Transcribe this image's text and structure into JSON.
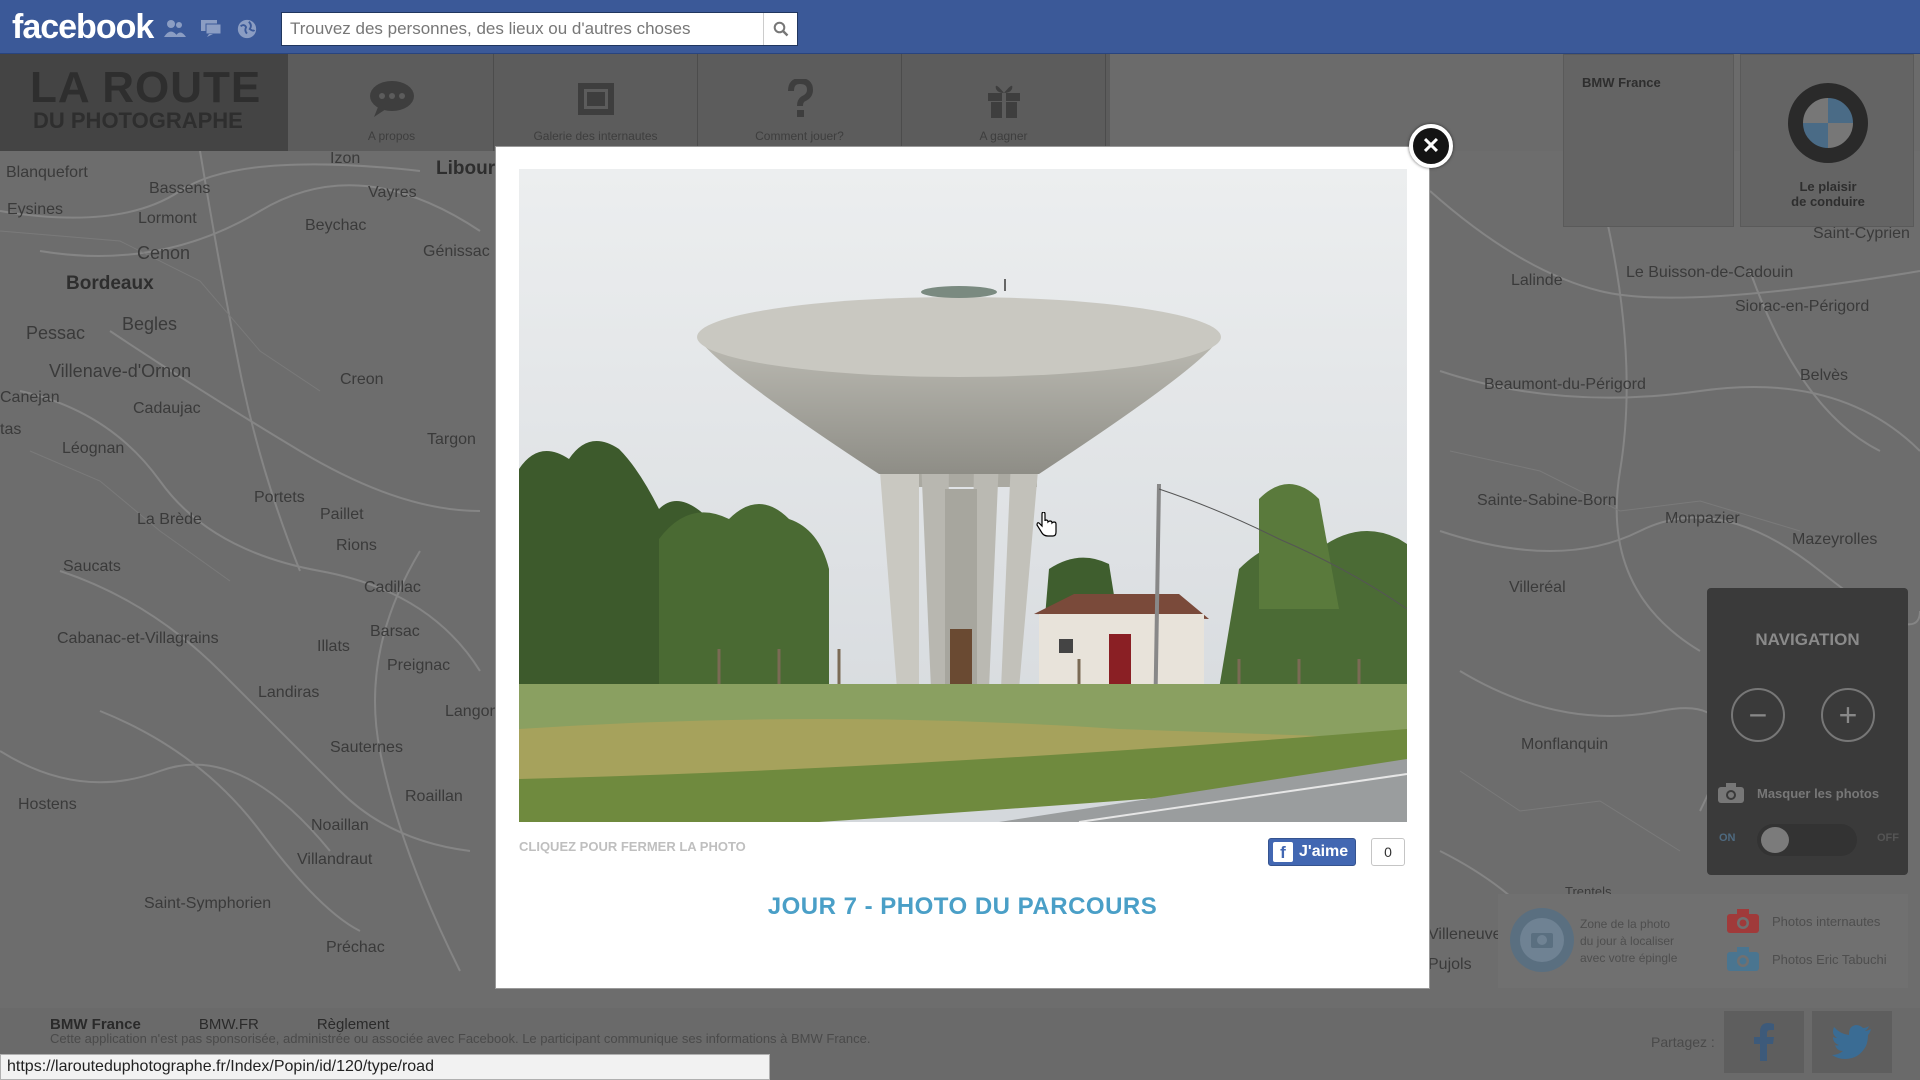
{
  "fb": {
    "logo": "facebook",
    "search_placeholder": "Trouvez des personnes, des lieux ou d'autres choses"
  },
  "app": {
    "logo_line1": "LA ROUTE",
    "logo_line2": "DU PHOTOGRAPHE",
    "nav": [
      {
        "label": "A propos"
      },
      {
        "label": "Galerie des internautes"
      },
      {
        "label": "Comment jouer?"
      },
      {
        "label": "A gagner"
      }
    ]
  },
  "map": {
    "places": [
      "Izon",
      "Libourne",
      "Blanquefort",
      "Bassens",
      "Vayres",
      "Eysines",
      "Lormont",
      "Beychac",
      "Génissac",
      "Cenon",
      "Bordeaux",
      "Pessac",
      "Begles",
      "Villenave-d'Ornon",
      "Creon",
      "Canejan",
      "Cadaujac",
      "tas",
      "Léognan",
      "Targon",
      "Portets",
      "La Brède",
      "Paillet",
      "Rions",
      "Saucats",
      "Cadillac",
      "Cabanac-et-Villagrains",
      "Illats",
      "Barsac",
      "Preignac",
      "Landiras",
      "Langon",
      "Sauternes",
      "Hostens",
      "Roaillan",
      "Noaillan",
      "Villandraut",
      "Saint-Symphorien",
      "Préchac",
      "Saint-Cyprien",
      "Lalinde",
      "Le Buisson-de-Cadouin",
      "Siorac-en-Périgord",
      "Beaumont-du-Périgord",
      "Belvès",
      "Sainte-Sabine-Born",
      "Monpazier",
      "Mazeyrolles",
      "Villeréal",
      "Monflanquin",
      "Trentels",
      "Villeneuve",
      "Pujols"
    ]
  },
  "bmw": {
    "card_title": "BMW France",
    "tagline_1": "Le plaisir",
    "tagline_2": "de conduire"
  },
  "navigation": {
    "title": "NAVIGATION",
    "zoom_out": "−",
    "zoom_in": "+",
    "hide_photos": "Masquer les photos",
    "toggle_on": "ON",
    "toggle_off": "OFF"
  },
  "legend": {
    "zone_line1": "Zone de la photo",
    "zone_line2": "du jour à localiser",
    "zone_line3": "avec votre épingle",
    "internautes": "Photos internautes",
    "tabuchi": "Photos Eric Tabuchi"
  },
  "footer": {
    "link1": "BMW France",
    "link2": "BMW.FR",
    "link3": "Règlement",
    "disclaimer": "Cette application n'est pas sponsorisée, administrée ou associée avec Facebook. Le participant communique ses informations à BMW France.",
    "share_label": "Partagez :"
  },
  "status_url": "https://larouteduphotographe.fr/Index/Popin/id/120/type/road",
  "modal": {
    "close_glyph": "✕",
    "close_hint": "CLIQUEZ POUR FERMER LA PHOTO",
    "like_label": "J'aime",
    "like_count": "0",
    "title": "JOUR 7 - PHOTO DU PARCOURS"
  },
  "colors": {
    "fb_blue": "#3b5998",
    "title_blue": "#4a9fc7",
    "like_blue": "#4267b2"
  }
}
